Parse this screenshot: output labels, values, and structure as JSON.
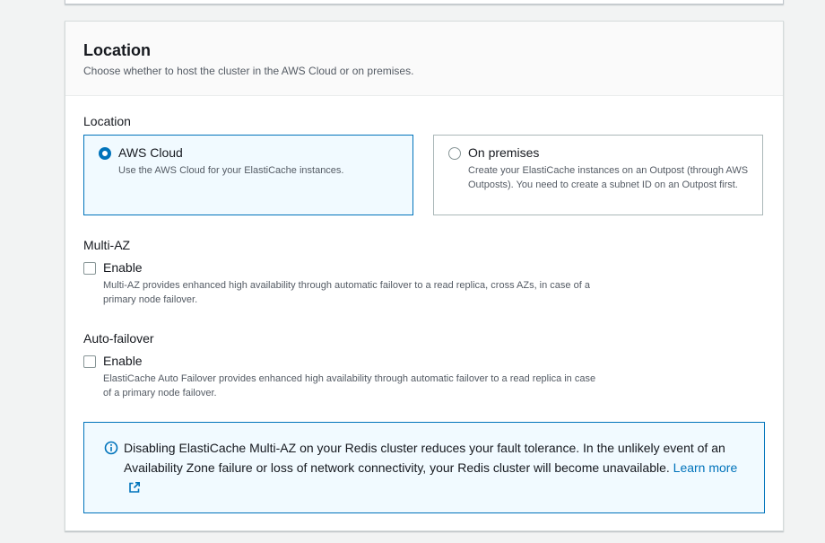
{
  "section": {
    "title": "Location",
    "description": "Choose whether to host the cluster in the AWS Cloud or on premises."
  },
  "location": {
    "label": "Location",
    "selected": "aws-cloud",
    "options": [
      {
        "title": "AWS Cloud",
        "description": "Use the AWS Cloud for your ElastiCache instances."
      },
      {
        "title": "On premises",
        "description": "Create your ElastiCache instances on an Outpost (through AWS Outposts). You need to create a subnet ID on an Outpost first."
      }
    ]
  },
  "multi_az": {
    "label": "Multi-AZ",
    "checkbox_label": "Enable",
    "checked": false,
    "description": "Multi-AZ provides enhanced high availability through automatic failover to a read replica, cross AZs, in case of a primary node failover."
  },
  "auto_failover": {
    "label": "Auto-failover",
    "checkbox_label": "Enable",
    "checked": false,
    "description": "ElastiCache Auto Failover provides enhanced high availability through automatic failover to a read replica in case of a primary node failover."
  },
  "alert": {
    "icon": "info-icon",
    "text": "Disabling ElastiCache Multi-AZ on your Redis cluster reduces your fault tolerance. In the unlikely event of an Availability Zone failure or loss of network connectivity, your Redis cluster will become unavailable.",
    "link_text": "Learn more",
    "link_icon": "external-link-icon"
  },
  "colors": {
    "accent": "#0073bb",
    "selected_bg": "#f1faff",
    "border": "#aab7b8",
    "page_bg": "#f2f3f3"
  }
}
